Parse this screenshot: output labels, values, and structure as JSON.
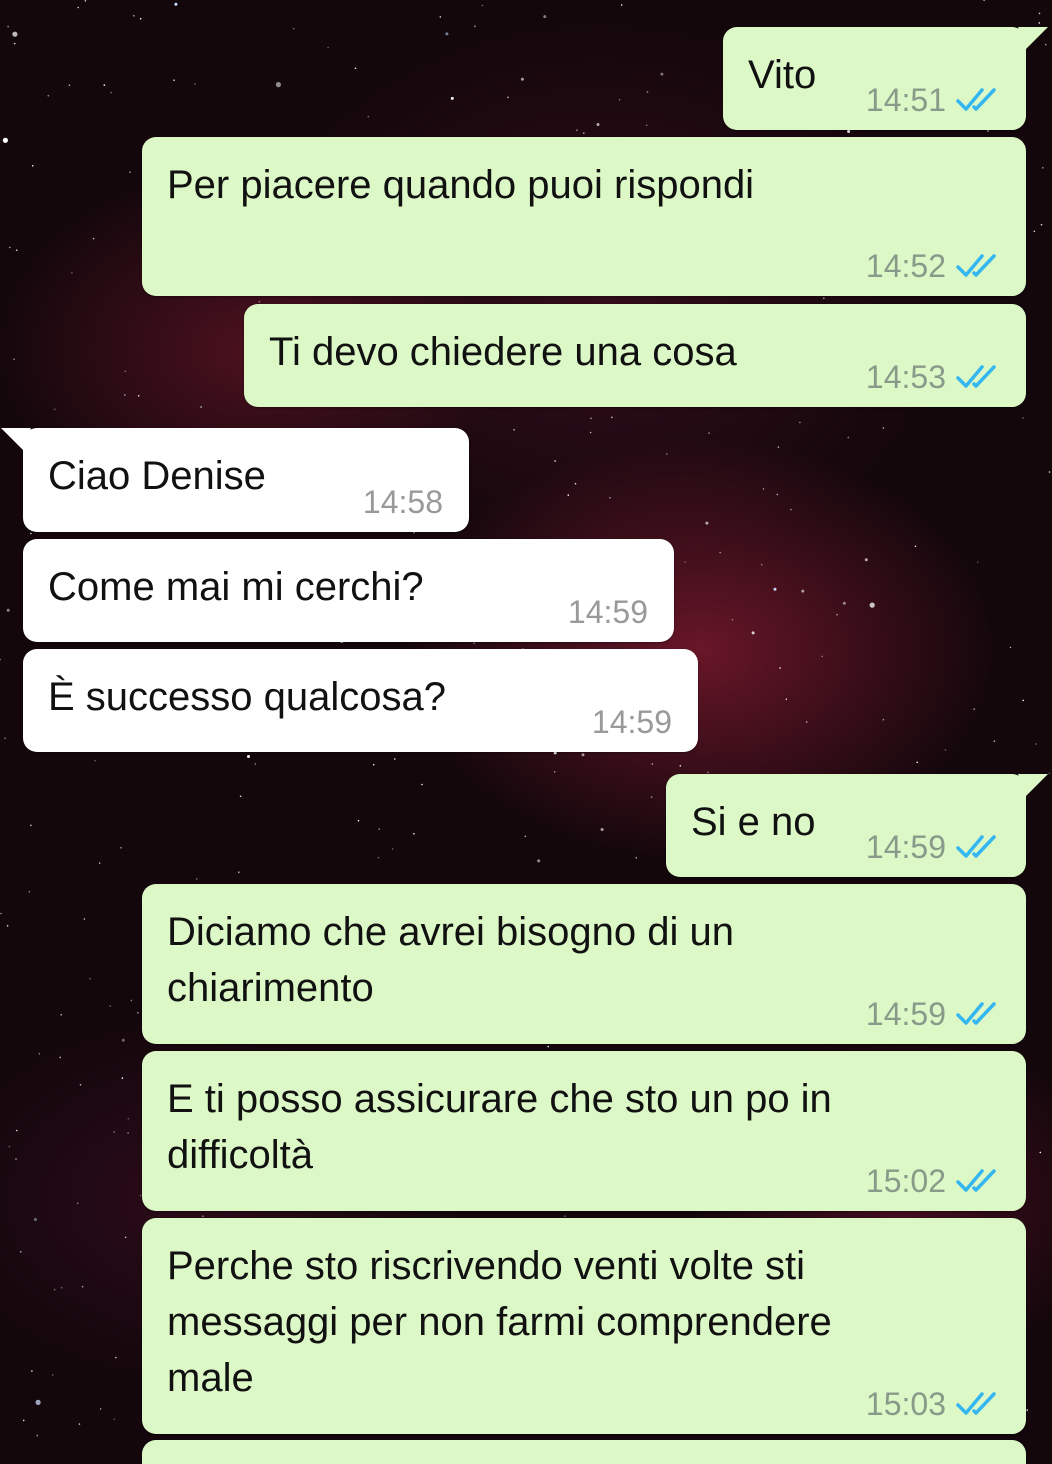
{
  "colors": {
    "outgoing_bubble": "#dcf8c6",
    "incoming_bubble": "#ffffff",
    "read_tick": "#34b7f1",
    "background": "#14070c"
  },
  "messages": [
    {
      "direction": "out",
      "text": "Vito",
      "time": "14:51",
      "status": "read-ticks-icon"
    },
    {
      "direction": "out",
      "text": "Per piacere quando puoi rispondi",
      "time": "14:52",
      "status": "read-ticks-icon"
    },
    {
      "direction": "out",
      "text": "Ti devo chiedere una cosa",
      "time": "14:53",
      "status": "read-ticks-icon"
    },
    {
      "direction": "in",
      "text": "Ciao Denise",
      "time": "14:58"
    },
    {
      "direction": "in",
      "text": "Come mai mi cerchi?",
      "time": "14:59"
    },
    {
      "direction": "in",
      "text": "È successo qualcosa?",
      "time": "14:59"
    },
    {
      "direction": "out",
      "text": "Si e no",
      "time": "14:59",
      "status": "read-ticks-icon"
    },
    {
      "direction": "out",
      "text": "Diciamo che avrei bisogno di un\nchiarimento",
      "time": "14:59",
      "status": "read-ticks-icon"
    },
    {
      "direction": "out",
      "text": "E ti posso assicurare che sto un po in\ndifficoltà",
      "time": "15:02",
      "status": "read-ticks-icon"
    },
    {
      "direction": "out",
      "text": "Perche sto riscrivendo venti volte sti\nmessaggi per non farmi comprendere\nmale",
      "time": "15:03",
      "status": "read-ticks-icon"
    }
  ]
}
